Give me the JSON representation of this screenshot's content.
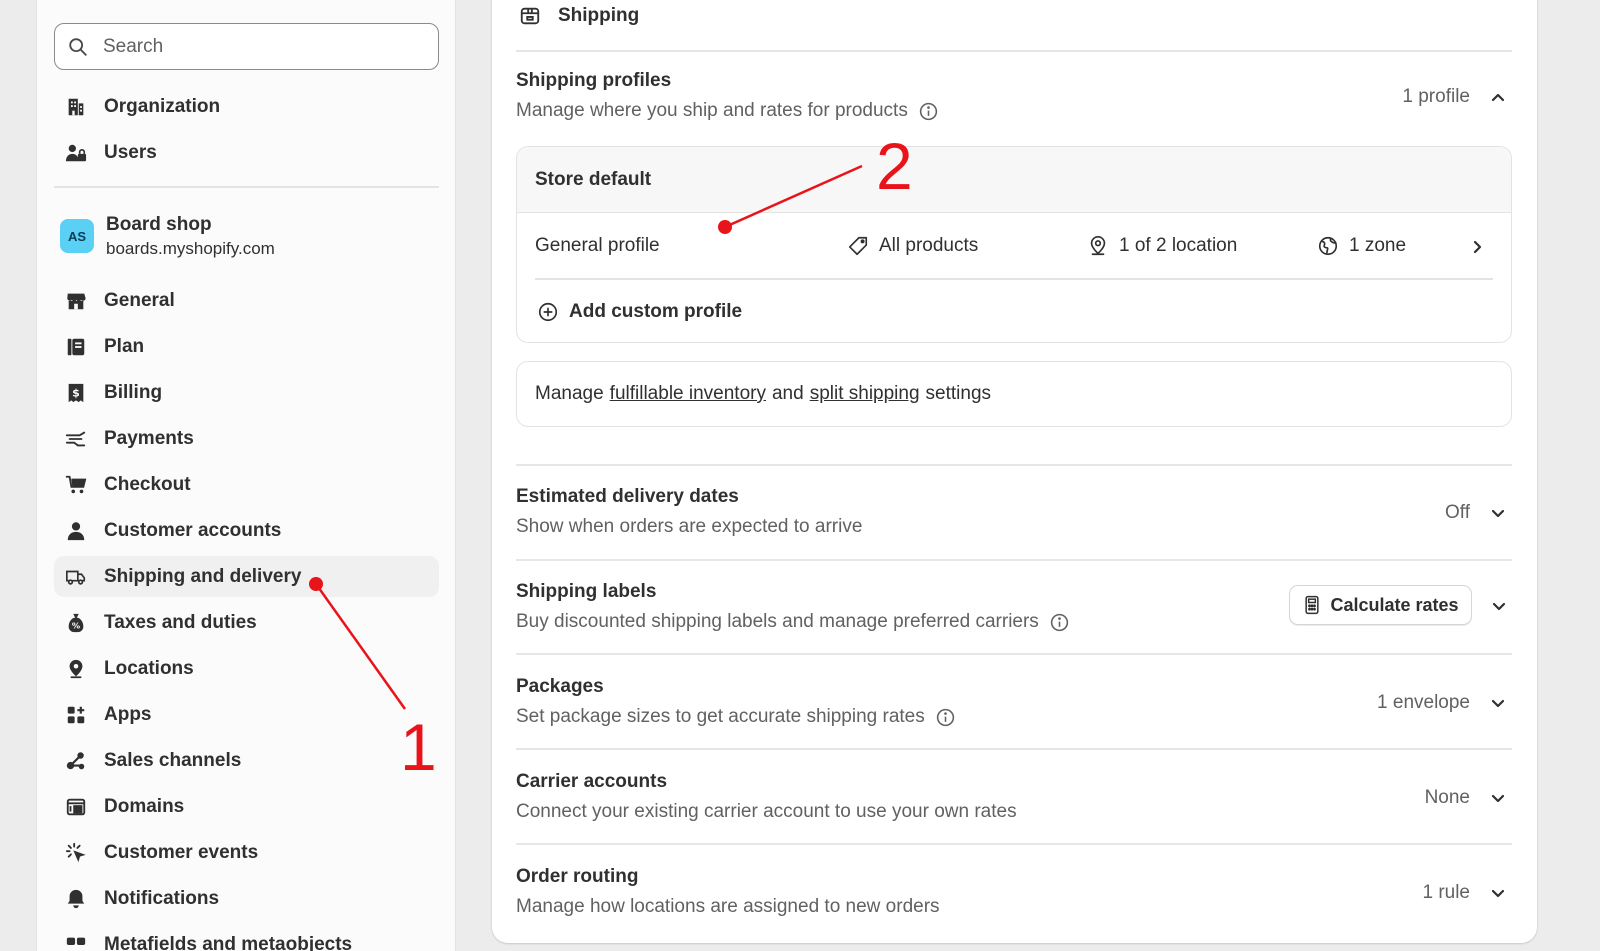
{
  "sidebar": {
    "search_placeholder": "Search",
    "top_items": [
      {
        "label": "Organization",
        "icon": "building-icon"
      },
      {
        "label": "Users",
        "icon": "users-icon"
      }
    ],
    "store": {
      "initials": "AS",
      "name": "Board shop",
      "domain": "boards.myshopify.com"
    },
    "items": [
      {
        "label": "General",
        "icon": "store-icon"
      },
      {
        "label": "Plan",
        "icon": "plan-icon"
      },
      {
        "label": "Billing",
        "icon": "billing-icon"
      },
      {
        "label": "Payments",
        "icon": "payments-icon"
      },
      {
        "label": "Checkout",
        "icon": "cart-icon"
      },
      {
        "label": "Customer accounts",
        "icon": "person-icon"
      },
      {
        "label": "Shipping and delivery",
        "icon": "truck-icon",
        "active": true
      },
      {
        "label": "Taxes and duties",
        "icon": "tax-icon"
      },
      {
        "label": "Locations",
        "icon": "location-icon"
      },
      {
        "label": "Apps",
        "icon": "apps-icon"
      },
      {
        "label": "Sales channels",
        "icon": "channels-icon"
      },
      {
        "label": "Domains",
        "icon": "domains-icon"
      },
      {
        "label": "Customer events",
        "icon": "cursor-icon"
      },
      {
        "label": "Notifications",
        "icon": "bell-icon"
      },
      {
        "label": "Metafields and metaobjects",
        "icon": "metafields-icon"
      }
    ]
  },
  "main": {
    "section_title": "Shipping",
    "shipping_profiles": {
      "title": "Shipping profiles",
      "description": "Manage where you ship and rates for products",
      "summary": "1 profile"
    },
    "store_default": {
      "title": "Store default",
      "profile_name": "General profile",
      "products": "All products",
      "locations": "1 of 2 location",
      "zones": "1 zone",
      "add_custom": "Add custom profile"
    },
    "manage": {
      "prefix": "Manage",
      "link1": "fulfillable inventory",
      "middle": "and",
      "link2": "split shipping",
      "suffix": "settings"
    },
    "estimated_delivery": {
      "title": "Estimated delivery dates",
      "description": "Show when orders are expected to arrive",
      "summary": "Off"
    },
    "shipping_labels": {
      "title": "Shipping labels",
      "description": "Buy discounted shipping labels and manage preferred carriers",
      "button": "Calculate rates"
    },
    "packages": {
      "title": "Packages",
      "description": "Set package sizes to get accurate shipping rates",
      "summary": "1 envelope"
    },
    "carrier_accounts": {
      "title": "Carrier accounts",
      "description": "Connect your existing carrier account to use your own rates",
      "summary": "None"
    },
    "order_routing": {
      "title": "Order routing",
      "description": "Manage how locations are assigned to new orders",
      "summary": "1 rule"
    }
  },
  "annotations": {
    "label1": "1",
    "label2": "2",
    "color": "#e8141a"
  }
}
